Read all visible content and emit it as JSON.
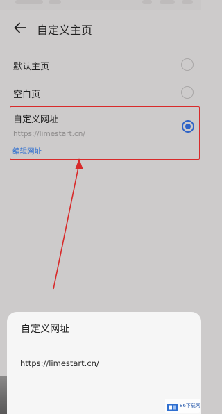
{
  "header": {
    "title": "自定义主页"
  },
  "options": [
    {
      "label": "默认主页",
      "selected": false
    },
    {
      "label": "空白页",
      "selected": false
    }
  ],
  "custom": {
    "label": "自定义网址",
    "url": "https://limestart.cn/",
    "edit_label": "编辑网址",
    "selected": true
  },
  "dialog": {
    "title": "自定义网址",
    "input_value": "https://limestart.cn/"
  },
  "watermark": {
    "text": "86下载网"
  },
  "colors": {
    "accent": "#2e63c7",
    "annotation": "#d82a2a",
    "link": "#2f6fd0"
  }
}
